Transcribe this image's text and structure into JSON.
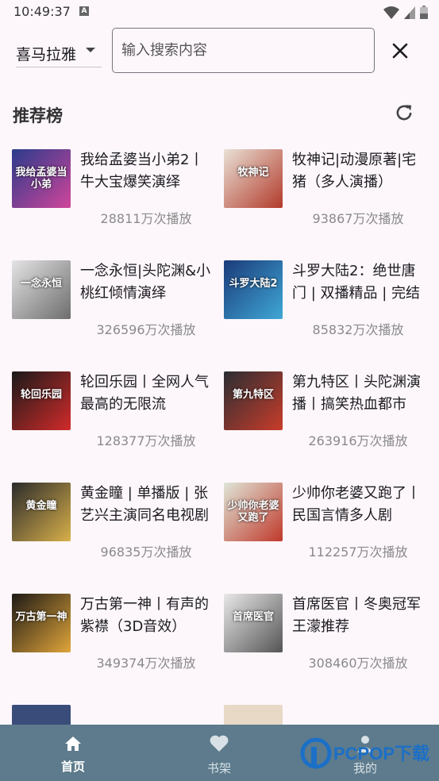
{
  "status_bar": {
    "time": "10:49:37",
    "notification_icon_letter": "A"
  },
  "search": {
    "source_label": "喜马拉雅",
    "placeholder": "输入搜索内容"
  },
  "section": {
    "title": "推荐榜"
  },
  "books": [
    {
      "title": "我给孟婆当小弟2丨牛大宝爆笑演绎",
      "plays": "28811万次播放",
      "cover_text": "我给孟婆当小弟",
      "cover_colors": [
        "#2a3b8c",
        "#d0459a"
      ]
    },
    {
      "title": "牧神记|动漫原著|宅猪（多人演播）",
      "plays": "93867万次播放",
      "cover_text": "牧神记",
      "cover_colors": [
        "#e9e1d6",
        "#b23a2a"
      ]
    },
    {
      "title": "一念永恒|头陀渊&小桃红倾情演绎",
      "plays": "326596万次播放",
      "cover_text": "一念永恒",
      "cover_colors": [
        "#e4e4e4",
        "#6d6d6d"
      ]
    },
    {
      "title": "斗罗大陆2：绝世唐门 | 双播精品 | 完结",
      "plays": "85832万次播放",
      "cover_text": "斗罗大陆2",
      "cover_colors": [
        "#1b3b7a",
        "#3fa7d6"
      ]
    },
    {
      "title": "轮回乐园丨全网人气最高的无限流",
      "plays": "128377万次播放",
      "cover_text": "轮回乐园",
      "cover_colors": [
        "#1a1a1a",
        "#d22a2a"
      ]
    },
    {
      "title": "第九特区丨头陀渊演播丨搞笑热血都市",
      "plays": "263916万次播放",
      "cover_text": "第九特区",
      "cover_colors": [
        "#2a2e33",
        "#c93c2a"
      ]
    },
    {
      "title": "黄金瞳 | 单播版 | 张艺兴主演同名电视剧",
      "plays": "96835万次播放",
      "cover_text": "黄金瞳",
      "cover_colors": [
        "#2b2b2b",
        "#d8b04a"
      ]
    },
    {
      "title": "少帅你老婆又跑了丨民国言情多人剧",
      "plays": "112257万次播放",
      "cover_text": "少帅你老婆又跑了",
      "cover_colors": [
        "#dfe6d8",
        "#c0392b"
      ]
    },
    {
      "title": "万古第一神丨有声的紫襟（3D音效）",
      "plays": "349374万次播放",
      "cover_text": "万古第一神",
      "cover_colors": [
        "#1e1a16",
        "#e0a53a"
      ]
    },
    {
      "title": "首席医官丨冬奥冠军王濛推荐",
      "plays": "308460万次播放",
      "cover_text": "首席医官",
      "cover_colors": [
        "#e8e8e8",
        "#555555"
      ]
    }
  ],
  "bottom_nav": [
    {
      "label": "首页",
      "icon": "home-icon"
    },
    {
      "label": "书架",
      "icon": "heart-icon"
    },
    {
      "label": "我的",
      "icon": "person-icon"
    }
  ],
  "watermark": {
    "text": "PCPOP下载"
  },
  "colors": {
    "background": "#fdf7fc",
    "nav_bar": "#5d7b8c",
    "plays_text": "#8a8a8a"
  }
}
